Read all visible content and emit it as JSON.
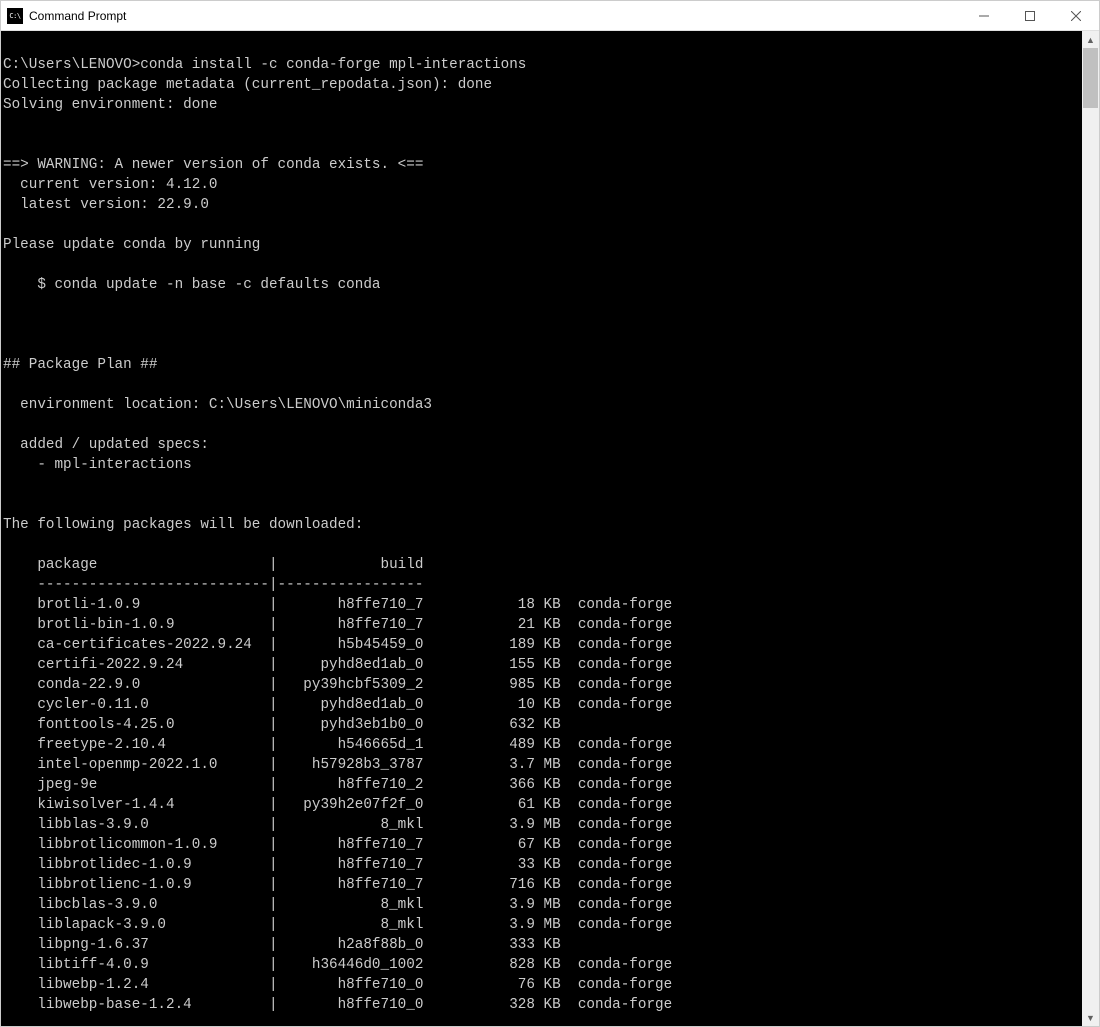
{
  "window_title": "Command Prompt",
  "icon_text": "C:\\",
  "prompt_line": "C:\\Users\\LENOVO>conda install -c conda-forge mpl-interactions",
  "collecting_line": "Collecting package metadata (current_repodata.json): done",
  "solving_line": "Solving environment: done",
  "warning_header": "==> WARNING: A newer version of conda exists. <==",
  "current_version_line": "  current version: 4.12.0",
  "latest_version_line": "  latest version: 22.9.0",
  "update_instruction": "Please update conda by running",
  "update_command": "    $ conda update -n base -c defaults conda",
  "package_plan_header": "## Package Plan ##",
  "env_location_line": "  environment location: C:\\Users\\LENOVO\\miniconda3",
  "added_specs_line": "  added / updated specs:",
  "spec_item": "    - mpl-interactions",
  "download_header": "The following packages will be downloaded:",
  "table_header_package": "package",
  "table_header_build": "build",
  "packages": [
    {
      "name": "brotli-1.0.9",
      "build": "h8ffe710_7",
      "size": "18 KB",
      "channel": "conda-forge"
    },
    {
      "name": "brotli-bin-1.0.9",
      "build": "h8ffe710_7",
      "size": "21 KB",
      "channel": "conda-forge"
    },
    {
      "name": "ca-certificates-2022.9.24",
      "build": "h5b45459_0",
      "size": "189 KB",
      "channel": "conda-forge"
    },
    {
      "name": "certifi-2022.9.24",
      "build": "pyhd8ed1ab_0",
      "size": "155 KB",
      "channel": "conda-forge"
    },
    {
      "name": "conda-22.9.0",
      "build": "py39hcbf5309_2",
      "size": "985 KB",
      "channel": "conda-forge"
    },
    {
      "name": "cycler-0.11.0",
      "build": "pyhd8ed1ab_0",
      "size": "10 KB",
      "channel": "conda-forge"
    },
    {
      "name": "fonttools-4.25.0",
      "build": "pyhd3eb1b0_0",
      "size": "632 KB",
      "channel": ""
    },
    {
      "name": "freetype-2.10.4",
      "build": "h546665d_1",
      "size": "489 KB",
      "channel": "conda-forge"
    },
    {
      "name": "intel-openmp-2022.1.0",
      "build": "h57928b3_3787",
      "size": "3.7 MB",
      "channel": "conda-forge"
    },
    {
      "name": "jpeg-9e",
      "build": "h8ffe710_2",
      "size": "366 KB",
      "channel": "conda-forge"
    },
    {
      "name": "kiwisolver-1.4.4",
      "build": "py39h2e07f2f_0",
      "size": "61 KB",
      "channel": "conda-forge"
    },
    {
      "name": "libblas-3.9.0",
      "build": "8_mkl",
      "size": "3.9 MB",
      "channel": "conda-forge"
    },
    {
      "name": "libbrotlicommon-1.0.9",
      "build": "h8ffe710_7",
      "size": "67 KB",
      "channel": "conda-forge"
    },
    {
      "name": "libbrotlidec-1.0.9",
      "build": "h8ffe710_7",
      "size": "33 KB",
      "channel": "conda-forge"
    },
    {
      "name": "libbrotlienc-1.0.9",
      "build": "h8ffe710_7",
      "size": "716 KB",
      "channel": "conda-forge"
    },
    {
      "name": "libcblas-3.9.0",
      "build": "8_mkl",
      "size": "3.9 MB",
      "channel": "conda-forge"
    },
    {
      "name": "liblapack-3.9.0",
      "build": "8_mkl",
      "size": "3.9 MB",
      "channel": "conda-forge"
    },
    {
      "name": "libpng-1.6.37",
      "build": "h2a8f88b_0",
      "size": "333 KB",
      "channel": ""
    },
    {
      "name": "libtiff-4.0.9",
      "build": "h36446d0_1002",
      "size": "828 KB",
      "channel": "conda-forge"
    },
    {
      "name": "libwebp-1.2.4",
      "build": "h8ffe710_0",
      "size": "76 KB",
      "channel": "conda-forge"
    },
    {
      "name": "libwebp-base-1.2.4",
      "build": "h8ffe710_0",
      "size": "328 KB",
      "channel": "conda-forge"
    }
  ]
}
